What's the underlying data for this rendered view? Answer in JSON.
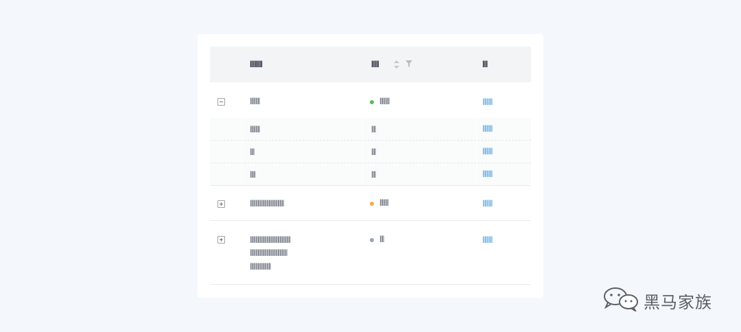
{
  "table": {
    "headers": {
      "name": "||||||||||",
      "status": "||||||",
      "action": "||||"
    },
    "rows": [
      {
        "name_lines": [
          "|||||||||"
        ],
        "status_color": "#5cb85c",
        "status_text": "|||||||||",
        "action": "|||||||||",
        "expanded": true,
        "children": [
          {
            "name": "|||||||||",
            "status": "||||",
            "action": "|||||||||"
          },
          {
            "name": "||||",
            "status": "||||",
            "action": "|||||||||"
          },
          {
            "name": "|||||",
            "status": "||||",
            "action": "|||||||||"
          }
        ]
      },
      {
        "name_lines": [
          "|||||||||||||||||||||||||||||||"
        ],
        "status_color": "#f0ad4e",
        "status_text": "||||||||",
        "action": "|||||||||",
        "expanded": false
      },
      {
        "name_lines": [
          "|||||||||||||||||||||||||||||||||||||",
          "||||||||||||||||||||||||||||||||||",
          "|||||||||||||||||||"
        ],
        "status_color": "#9aa4b1",
        "status_text": "||||",
        "action": "|||||||||",
        "expanded": false
      }
    ]
  },
  "icons": {
    "sort": "sort-icon",
    "filter": "filter-icon",
    "collapse": "minus-square-icon",
    "expand": "plus-square-icon"
  },
  "watermark": {
    "text": "黑马家族"
  }
}
